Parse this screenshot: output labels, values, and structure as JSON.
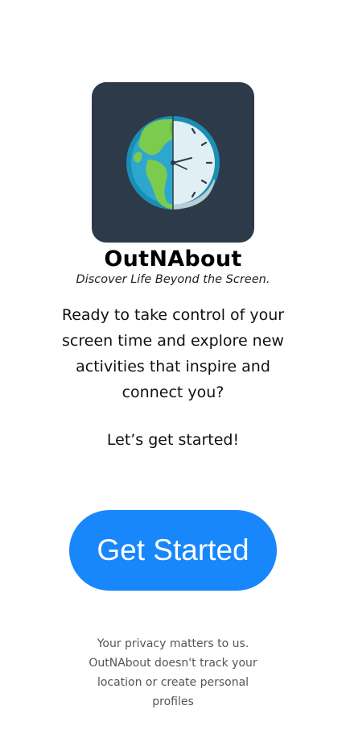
{
  "app": {
    "title": "OutNAbout",
    "tagline": "Discover Life Beyond the Screen."
  },
  "logo": {
    "icon": "globe-clock-icon",
    "background_color": "#2d3a4a"
  },
  "intro": {
    "text": "Ready to take control of your screen time and explore new activities that inspire and connect you?",
    "cta_line": "Let’s get started!"
  },
  "actions": {
    "get_started_label": "Get Started",
    "accent_color": "#1787fb"
  },
  "footer": {
    "privacy_text": "Your privacy matters to us. OutNAbout doesn't track your location or create personal profiles"
  }
}
